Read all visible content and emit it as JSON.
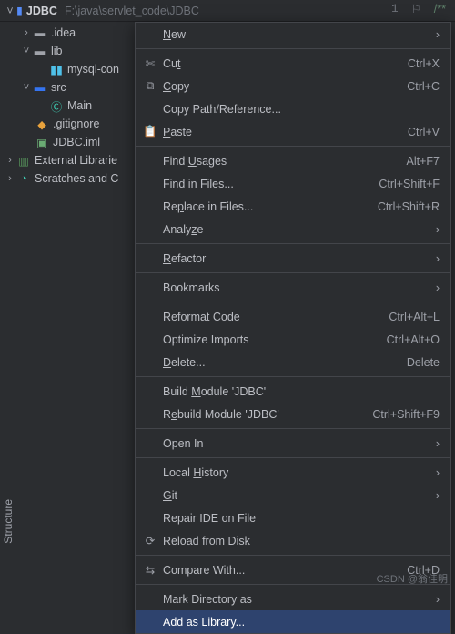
{
  "editor": {
    "line_number": "1",
    "comment_start": "/**"
  },
  "header": {
    "project_name": "JDBC",
    "project_path": "F:\\java\\servlet_code\\JDBC"
  },
  "tree": {
    "idea": ".idea",
    "lib": "lib",
    "mysql_con": "mysql-con",
    "src": "src",
    "main": "Main",
    "gitignore": ".gitignore",
    "jdbc_iml": "JDBC.iml",
    "ext_lib": "External Librarie",
    "scratches": "Scratches and C"
  },
  "side_tab": "Structure",
  "menu": {
    "new": "New",
    "cut": "Cut",
    "cut_u": "t",
    "cut_s": "Ctrl+X",
    "copy": "Copy",
    "copy_u": "C",
    "copy_s": "Ctrl+C",
    "copy_path": "Copy Path/Reference...",
    "paste": "Paste",
    "paste_u": "P",
    "paste_s": "Ctrl+V",
    "find_usages": "Find Usages",
    "find_usages_u": "U",
    "find_usages_s": "Alt+F7",
    "find_in_files": "Find in Files...",
    "find_in_files_s": "Ctrl+Shift+F",
    "replace_in_files": "Replace in Files...",
    "replace_in_files_u": "p",
    "replace_in_files_s": "Ctrl+Shift+R",
    "analyze": "Analyze",
    "analyze_u": "z",
    "refactor": "Refactor",
    "refactor_u": "R",
    "bookmarks": "Bookmarks",
    "reformat": "Reformat Code",
    "reformat_u": "R",
    "reformat_s": "Ctrl+Alt+L",
    "optimize": "Optimize Imports",
    "optimize_s": "Ctrl+Alt+O",
    "delete": "Delete...",
    "delete_u": "D",
    "delete_s": "Delete",
    "build_module": "Build Module 'JDBC'",
    "build_module_u": "M",
    "rebuild_module": "Rebuild Module 'JDBC'",
    "rebuild_module_u": "e",
    "rebuild_module_s": "Ctrl+Shift+F9",
    "open_in": "Open In",
    "local_history": "Local History",
    "local_history_u": "H",
    "git": "Git",
    "git_u": "G",
    "repair": "Repair IDE on File",
    "reload": "Reload from Disk",
    "compare": "Compare With...",
    "compare_s": "Ctrl+D",
    "mark_dir": "Mark Directory as",
    "add_lib": "Add as Library..."
  },
  "watermark": "CSDN @翁佳明"
}
